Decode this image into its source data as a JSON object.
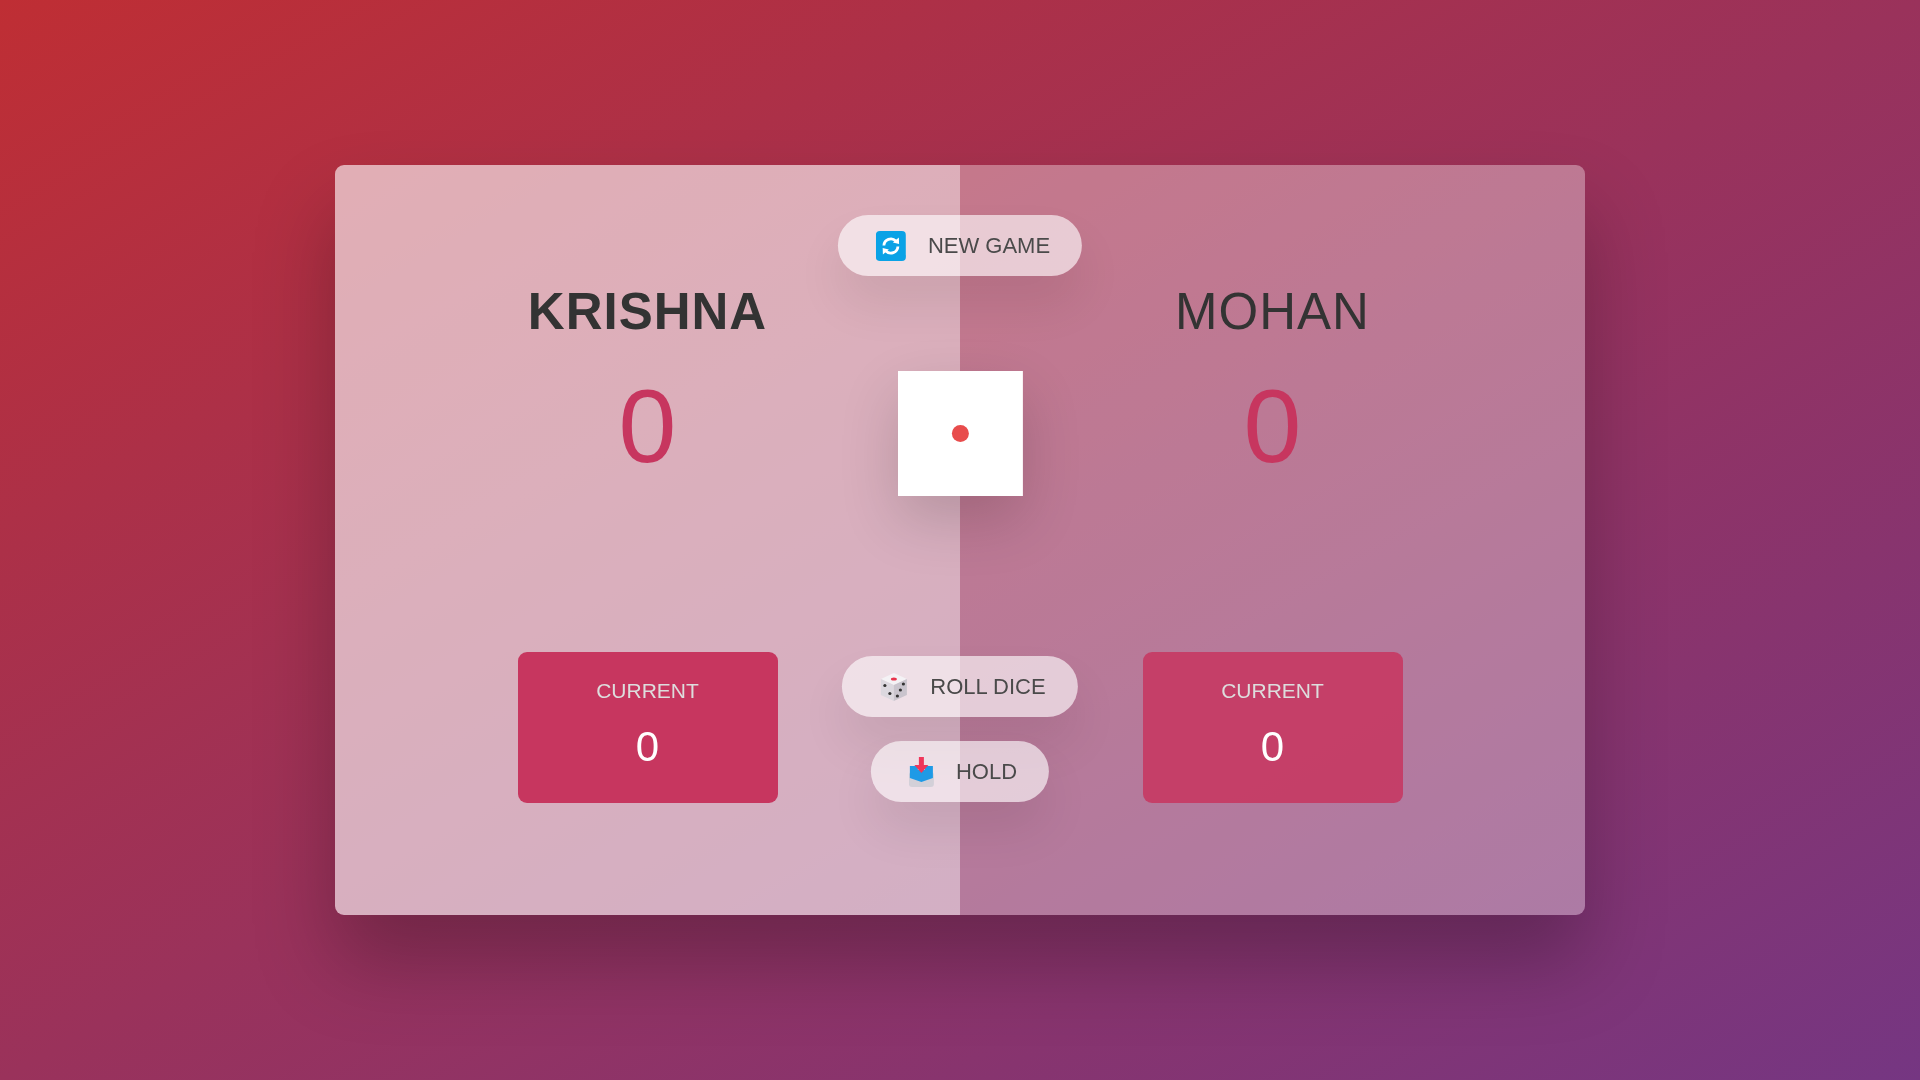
{
  "players": [
    {
      "name": "KRISHNA",
      "score": "0",
      "current_label": "CURRENT",
      "current": "0",
      "active": true
    },
    {
      "name": "MOHAN",
      "score": "0",
      "current_label": "CURRENT",
      "current": "0",
      "active": false
    }
  ],
  "dice": {
    "pips": [
      {
        "on": false
      },
      {
        "on": false
      },
      {
        "on": false
      },
      {
        "on": false
      },
      {
        "on": true
      },
      {
        "on": false
      },
      {
        "on": false
      },
      {
        "on": false
      },
      {
        "on": false
      }
    ]
  },
  "buttons": [
    {
      "kind": "new",
      "label": "NEW GAME"
    },
    {
      "kind": "roll",
      "label": "ROLL DICE"
    },
    {
      "kind": "hold",
      "label": "HOLD"
    }
  ]
}
